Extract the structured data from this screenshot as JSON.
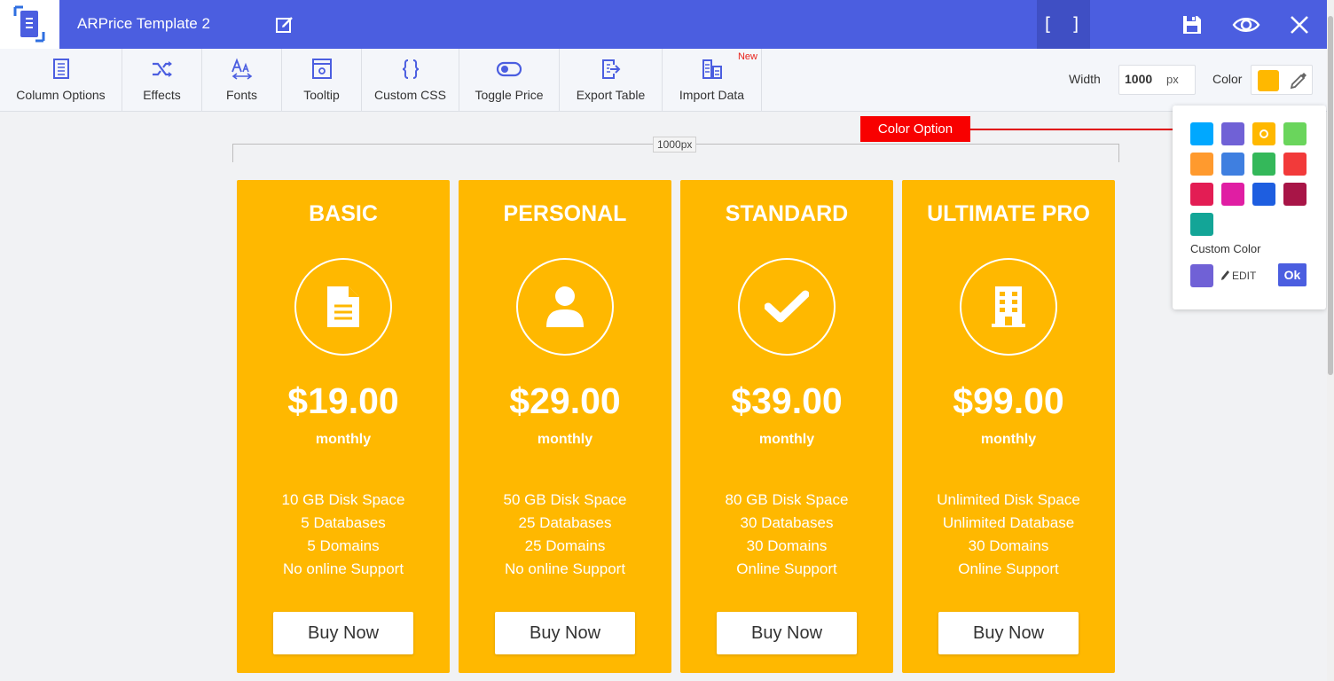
{
  "header": {
    "title": "ARPrice Template 2",
    "fullscreen_label": "[ ]",
    "icons": [
      "logo-icon",
      "edit-icon",
      "save-icon",
      "eye-icon",
      "close-icon"
    ]
  },
  "toolbar": {
    "tools": [
      {
        "label": "Column Options",
        "icon": "column-options-icon"
      },
      {
        "label": "Effects",
        "icon": "shuffle-icon"
      },
      {
        "label": "Fonts",
        "icon": "font-icon"
      },
      {
        "label": "Tooltip",
        "icon": "tooltip-icon"
      },
      {
        "label": "Custom CSS",
        "icon": "braces-icon"
      },
      {
        "label": "Toggle Price",
        "icon": "toggle-icon"
      },
      {
        "label": "Export Table",
        "icon": "export-icon"
      },
      {
        "label": "Import Data",
        "icon": "import-icon",
        "badge": "New"
      }
    ],
    "width_label": "Width",
    "width_value": "1000",
    "width_unit": "px",
    "color_label": "Color",
    "current_color": "#ffb800"
  },
  "canvas": {
    "ruler_label": "1000px"
  },
  "callout": {
    "label": "Color Option"
  },
  "palette": {
    "swatches": [
      "#00a8ff",
      "#7061d6",
      "#ffb800",
      "#6ad55c",
      "#ff9a2e",
      "#3f7fe0",
      "#34b85a",
      "#f23a3a",
      "#e31d54",
      "#e01ea3",
      "#1e5ee0",
      "#a81547",
      "#13a597"
    ],
    "selected": "#ffb800",
    "custom_label": "Custom Color",
    "custom_color": "#7061d6",
    "edit_label": "EDIT",
    "ok_label": "Ok"
  },
  "plans": [
    {
      "name": "BASIC",
      "icon": "document-icon",
      "price": "$19.00",
      "period": "monthly",
      "features": [
        "10 GB Disk Space",
        "5 Databases",
        "5 Domains",
        "No online Support"
      ],
      "button": "Buy Now"
    },
    {
      "name": "PERSONAL",
      "icon": "user-icon",
      "price": "$29.00",
      "period": "monthly",
      "features": [
        "50 GB Disk Space",
        "25 Databases",
        "25 Domains",
        "No online Support"
      ],
      "button": "Buy Now"
    },
    {
      "name": "STANDARD",
      "icon": "checkmark-icon",
      "price": "$39.00",
      "period": "monthly",
      "features": [
        "80 GB Disk Space",
        "30 Databases",
        "30 Domains",
        "Online Support"
      ],
      "button": "Buy Now"
    },
    {
      "name": "ULTIMATE PRO",
      "icon": "building-icon",
      "price": "$99.00",
      "period": "monthly",
      "features": [
        "Unlimited Disk Space",
        "Unlimited Database",
        "30 Domains",
        "Online Support"
      ],
      "button": "Buy Now"
    }
  ]
}
